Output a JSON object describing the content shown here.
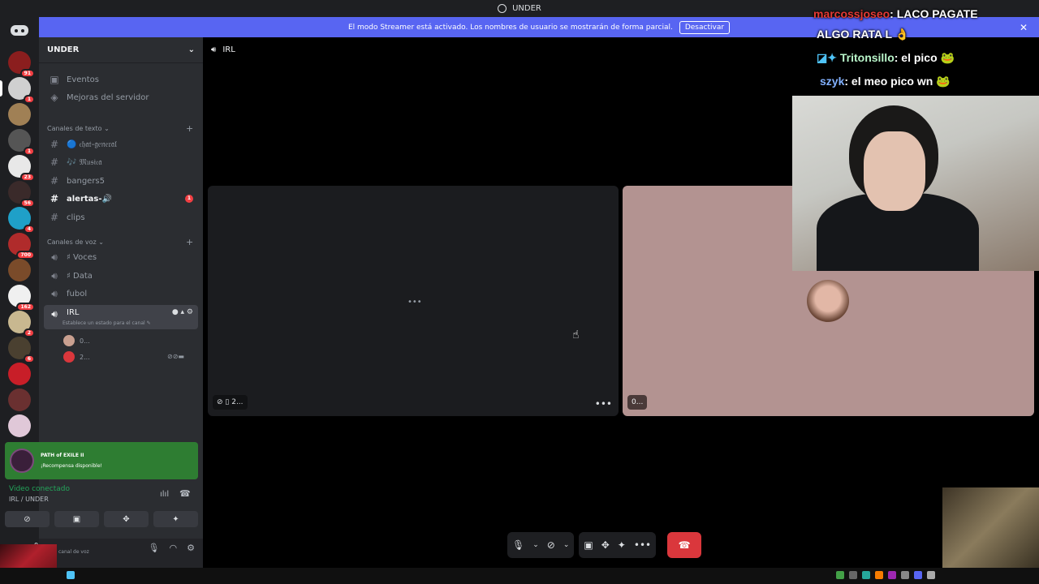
{
  "window": {
    "title": "UNDER"
  },
  "banner": {
    "text": "El modo Streamer está activado. Los nombres de usuario se mostrarán de forma parcial.",
    "button": "Desactivar"
  },
  "server": {
    "name": "UNDER"
  },
  "sidebar": {
    "top_items": [
      {
        "label": "Eventos"
      },
      {
        "label": "Mejoras del servidor"
      }
    ],
    "text_category": "Canales de texto",
    "text_channels": [
      {
        "label": "🔵 𝔠𝔥𝔞𝔱-𝔤𝔢𝔫𝔢𝔯𝔞𝔩"
      },
      {
        "label": "🎶 𝔐𝔲𝔰𝔦𝔠𝔞"
      },
      {
        "label": "bangers5"
      },
      {
        "label": "alertas-🔊",
        "badge": "1"
      },
      {
        "label": "clips"
      }
    ],
    "voice_category": "Canales de voz",
    "voice_channels": [
      {
        "label": "♯ Voces"
      },
      {
        "label": "♯ Data"
      },
      {
        "label": "fubol"
      },
      {
        "label": "IRL"
      }
    ],
    "irl_status": "Establece un estado para el canal",
    "voice_users": [
      {
        "name": "0..."
      },
      {
        "name": "2..."
      }
    ]
  },
  "server_badges": [
    "91",
    "1",
    "1",
    "23",
    "56",
    "4",
    "700",
    "162",
    "2",
    "6"
  ],
  "promo": {
    "title": "PATH of EXILE II",
    "subtitle": "¡Recompensa disponible!"
  },
  "voice_connection": {
    "status": "Video conectado",
    "location": "IRL / UNDER"
  },
  "userbar": {
    "name": "0...",
    "status": "canal de voz"
  },
  "main": {
    "channel": "IRL",
    "tile_left_label": "2...",
    "tile_right_label": "0..."
  },
  "overlay_chat": [
    {
      "user": "marcossjoseo",
      "msg": ": LACO PAGATE",
      "color": "#e53935"
    },
    {
      "user": "",
      "msg": "ALGO RATA L 👌",
      "color": "#ffffff"
    },
    {
      "user": "Tritonsillo",
      "msg": ": el pico 🐸",
      "color": "#b9f6ca"
    },
    {
      "user": "szyk",
      "msg": ": el meo pico wn 🐸",
      "color": "#82b1ff"
    }
  ]
}
